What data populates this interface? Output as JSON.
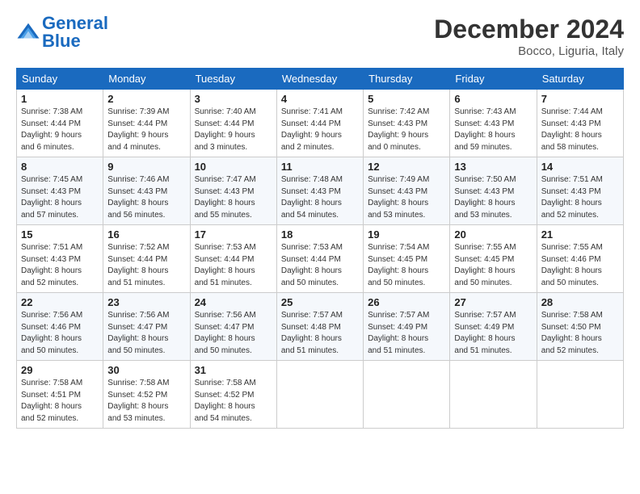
{
  "logo": {
    "line1": "General",
    "line2": "Blue"
  },
  "title": "December 2024",
  "location": "Bocco, Liguria, Italy",
  "headers": [
    "Sunday",
    "Monday",
    "Tuesday",
    "Wednesday",
    "Thursday",
    "Friday",
    "Saturday"
  ],
  "weeks": [
    [
      {
        "day": "1",
        "info": "Sunrise: 7:38 AM\nSunset: 4:44 PM\nDaylight: 9 hours\nand 6 minutes."
      },
      {
        "day": "2",
        "info": "Sunrise: 7:39 AM\nSunset: 4:44 PM\nDaylight: 9 hours\nand 4 minutes."
      },
      {
        "day": "3",
        "info": "Sunrise: 7:40 AM\nSunset: 4:44 PM\nDaylight: 9 hours\nand 3 minutes."
      },
      {
        "day": "4",
        "info": "Sunrise: 7:41 AM\nSunset: 4:44 PM\nDaylight: 9 hours\nand 2 minutes."
      },
      {
        "day": "5",
        "info": "Sunrise: 7:42 AM\nSunset: 4:43 PM\nDaylight: 9 hours\nand 0 minutes."
      },
      {
        "day": "6",
        "info": "Sunrise: 7:43 AM\nSunset: 4:43 PM\nDaylight: 8 hours\nand 59 minutes."
      },
      {
        "day": "7",
        "info": "Sunrise: 7:44 AM\nSunset: 4:43 PM\nDaylight: 8 hours\nand 58 minutes."
      }
    ],
    [
      {
        "day": "8",
        "info": "Sunrise: 7:45 AM\nSunset: 4:43 PM\nDaylight: 8 hours\nand 57 minutes."
      },
      {
        "day": "9",
        "info": "Sunrise: 7:46 AM\nSunset: 4:43 PM\nDaylight: 8 hours\nand 56 minutes."
      },
      {
        "day": "10",
        "info": "Sunrise: 7:47 AM\nSunset: 4:43 PM\nDaylight: 8 hours\nand 55 minutes."
      },
      {
        "day": "11",
        "info": "Sunrise: 7:48 AM\nSunset: 4:43 PM\nDaylight: 8 hours\nand 54 minutes."
      },
      {
        "day": "12",
        "info": "Sunrise: 7:49 AM\nSunset: 4:43 PM\nDaylight: 8 hours\nand 53 minutes."
      },
      {
        "day": "13",
        "info": "Sunrise: 7:50 AM\nSunset: 4:43 PM\nDaylight: 8 hours\nand 53 minutes."
      },
      {
        "day": "14",
        "info": "Sunrise: 7:51 AM\nSunset: 4:43 PM\nDaylight: 8 hours\nand 52 minutes."
      }
    ],
    [
      {
        "day": "15",
        "info": "Sunrise: 7:51 AM\nSunset: 4:43 PM\nDaylight: 8 hours\nand 52 minutes."
      },
      {
        "day": "16",
        "info": "Sunrise: 7:52 AM\nSunset: 4:44 PM\nDaylight: 8 hours\nand 51 minutes."
      },
      {
        "day": "17",
        "info": "Sunrise: 7:53 AM\nSunset: 4:44 PM\nDaylight: 8 hours\nand 51 minutes."
      },
      {
        "day": "18",
        "info": "Sunrise: 7:53 AM\nSunset: 4:44 PM\nDaylight: 8 hours\nand 50 minutes."
      },
      {
        "day": "19",
        "info": "Sunrise: 7:54 AM\nSunset: 4:45 PM\nDaylight: 8 hours\nand 50 minutes."
      },
      {
        "day": "20",
        "info": "Sunrise: 7:55 AM\nSunset: 4:45 PM\nDaylight: 8 hours\nand 50 minutes."
      },
      {
        "day": "21",
        "info": "Sunrise: 7:55 AM\nSunset: 4:46 PM\nDaylight: 8 hours\nand 50 minutes."
      }
    ],
    [
      {
        "day": "22",
        "info": "Sunrise: 7:56 AM\nSunset: 4:46 PM\nDaylight: 8 hours\nand 50 minutes."
      },
      {
        "day": "23",
        "info": "Sunrise: 7:56 AM\nSunset: 4:47 PM\nDaylight: 8 hours\nand 50 minutes."
      },
      {
        "day": "24",
        "info": "Sunrise: 7:56 AM\nSunset: 4:47 PM\nDaylight: 8 hours\nand 50 minutes."
      },
      {
        "day": "25",
        "info": "Sunrise: 7:57 AM\nSunset: 4:48 PM\nDaylight: 8 hours\nand 51 minutes."
      },
      {
        "day": "26",
        "info": "Sunrise: 7:57 AM\nSunset: 4:49 PM\nDaylight: 8 hours\nand 51 minutes."
      },
      {
        "day": "27",
        "info": "Sunrise: 7:57 AM\nSunset: 4:49 PM\nDaylight: 8 hours\nand 51 minutes."
      },
      {
        "day": "28",
        "info": "Sunrise: 7:58 AM\nSunset: 4:50 PM\nDaylight: 8 hours\nand 52 minutes."
      }
    ],
    [
      {
        "day": "29",
        "info": "Sunrise: 7:58 AM\nSunset: 4:51 PM\nDaylight: 8 hours\nand 52 minutes."
      },
      {
        "day": "30",
        "info": "Sunrise: 7:58 AM\nSunset: 4:52 PM\nDaylight: 8 hours\nand 53 minutes."
      },
      {
        "day": "31",
        "info": "Sunrise: 7:58 AM\nSunset: 4:52 PM\nDaylight: 8 hours\nand 54 minutes."
      },
      {
        "day": "",
        "info": ""
      },
      {
        "day": "",
        "info": ""
      },
      {
        "day": "",
        "info": ""
      },
      {
        "day": "",
        "info": ""
      }
    ]
  ]
}
